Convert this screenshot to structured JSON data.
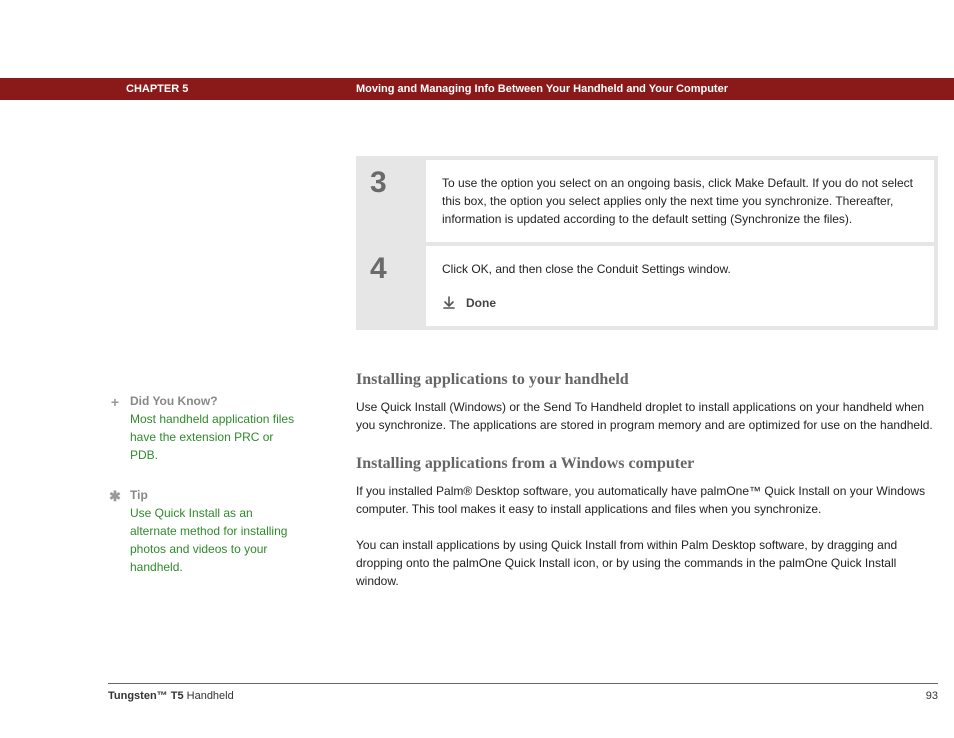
{
  "header": {
    "chapter": "CHAPTER 5",
    "title": "Moving and Managing Info Between Your Handheld and Your Computer"
  },
  "steps": [
    {
      "num": "3",
      "body": "To use the option you select on an ongoing basis, click Make Default. If you do not select this box, the option you select applies only the next time you synchronize. Thereafter, information is updated according to the default setting (Synchronize the files)."
    },
    {
      "num": "4",
      "body": "Click OK, and then close the Conduit Settings window.",
      "done": "Done"
    }
  ],
  "sidebar": [
    {
      "icon": "plus",
      "head": "Did You Know?",
      "body": "Most handheld application files have the extension PRC or PDB."
    },
    {
      "icon": "asterisk",
      "head": "Tip",
      "body": "Use Quick Install as an alternate method for installing photos and videos to your handheld."
    }
  ],
  "sections": [
    {
      "heading": "Installing applications to your handheld",
      "paragraphs": [
        "Use Quick Install (Windows) or the Send To Handheld droplet to install applications on your handheld when you synchronize. The applications are stored in program memory and are optimized for use on the handheld."
      ]
    },
    {
      "heading": "Installing applications from a Windows computer",
      "paragraphs": [
        "If you installed Palm® Desktop software, you automatically have palmOne™ Quick Install on your Windows computer. This tool makes it easy to install applications and files when you synchronize.",
        "You can install applications by using Quick Install from within Palm Desktop software, by dragging and dropping onto the palmOne Quick Install icon, or by using the commands in the palmOne Quick Install window."
      ]
    }
  ],
  "footer": {
    "product_bold": "Tungsten™ T5",
    "product_rest": " Handheld",
    "page": "93"
  }
}
